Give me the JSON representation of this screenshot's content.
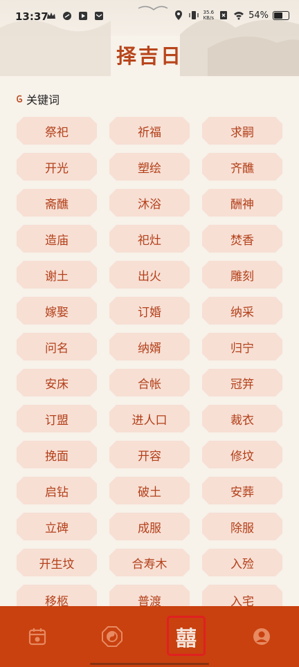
{
  "status": {
    "time": "13:37",
    "speed_value": "35.6",
    "speed_unit": "KB/s",
    "battery": "54%"
  },
  "title": "择吉日",
  "section": {
    "label": "关键词"
  },
  "keywords": [
    "祭祀",
    "祈福",
    "求嗣",
    "开光",
    "塑绘",
    "齐醮",
    "斋醮",
    "沐浴",
    "酬神",
    "造庙",
    "祀灶",
    "焚香",
    "谢土",
    "出火",
    "雕刻",
    "嫁娶",
    "订婚",
    "纳采",
    "问名",
    "纳婿",
    "归宁",
    "安床",
    "合帐",
    "冠笄",
    "订盟",
    "进人口",
    "裁衣",
    "挽面",
    "开容",
    "修坟",
    "启钻",
    "破土",
    "安葬",
    "立碑",
    "成服",
    "除服",
    "开生坟",
    "合寿木",
    "入殓",
    "移柩",
    "普渡",
    "入宅"
  ],
  "nav": {
    "center_glyph": "囍",
    "items": [
      "calendar-icon",
      "bagua-icon",
      "double-happiness-icon",
      "profile-icon"
    ]
  },
  "colors": {
    "accent": "#b8451b",
    "chip_bg": "#f7dfd4",
    "nav_bg": "#c8410f",
    "highlight": "#e02020"
  }
}
